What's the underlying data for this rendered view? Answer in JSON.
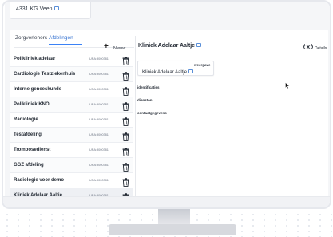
{
  "address": {
    "line": "4331 KG Veen"
  },
  "tabs": [
    {
      "label": "Zorgverleners"
    },
    {
      "label": "Afdelingen"
    }
  ],
  "new_button": {
    "label": "Nieuw"
  },
  "rows": [
    {
      "name": "Polikliniek adelaar",
      "code": "URA:9000381"
    },
    {
      "name": "Cardiologie Testziekenhuis",
      "code": "URA:9000381"
    },
    {
      "name": "Interne geneeskunde",
      "code": "URA:9000381"
    },
    {
      "name": "Polikliniek KNO",
      "code": "URA:9000381"
    },
    {
      "name": "Radiologie",
      "code": "URA:9000381"
    },
    {
      "name": "Testafdeling",
      "code": "URA:9000381"
    },
    {
      "name": "Trombosedienst",
      "code": "URA:9000381"
    },
    {
      "name": "GGZ afdeling",
      "code": "URA:9000381"
    },
    {
      "name": "Radiologie voor demo",
      "code": "URA:9000381"
    },
    {
      "name": "Kliniek Adelaar Aaltje",
      "code": "URA:9000381"
    }
  ],
  "detail": {
    "title": "Kliniek Adelaar Aaltje",
    "details_label": "Details",
    "weergave_label": "weergave",
    "weergave_value": "Kliniek Adelaar Aaltje",
    "sections": [
      "identificaties",
      "diensten",
      "contactgegevens"
    ]
  },
  "colors": {
    "accent": "#3b82f6",
    "icon": "#5a8fd8",
    "text": "#1f2630"
  }
}
